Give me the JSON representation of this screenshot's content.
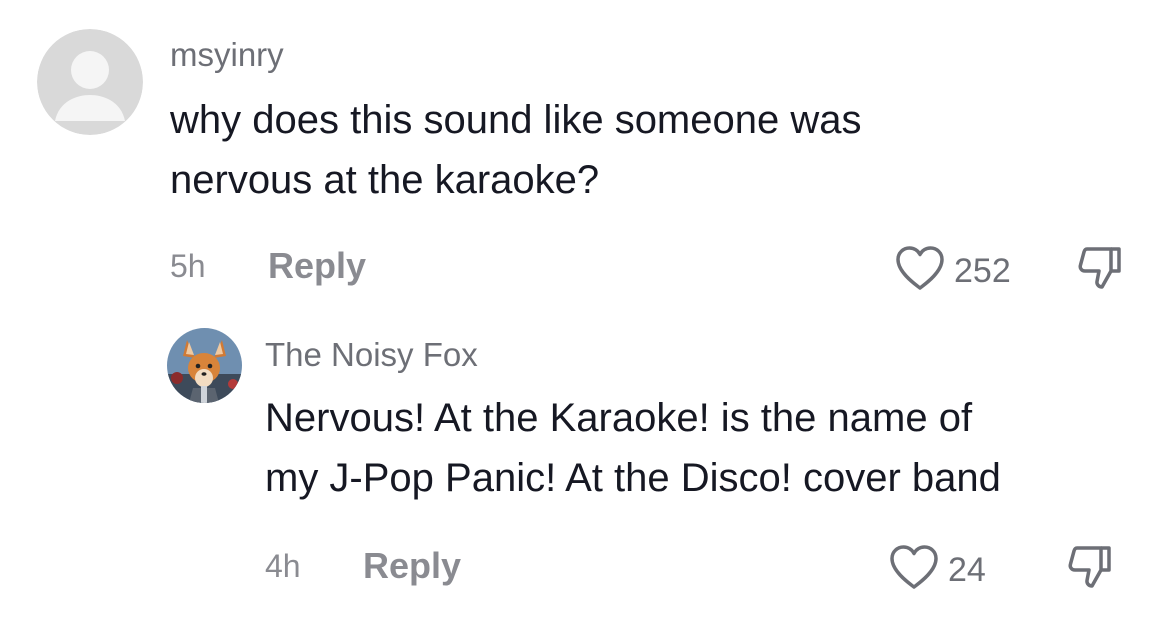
{
  "comments": [
    {
      "username": "msyinry",
      "text_lines": [
        "why does this sound like someone was",
        "nervous at the karaoke?"
      ],
      "time": "5h",
      "reply_label": "Reply",
      "likes": "252",
      "avatar_icon": "default-user-avatar-icon"
    }
  ],
  "replies": [
    {
      "username": "The Noisy Fox",
      "text_lines": [
        "Nervous! At the Karaoke! is the name of",
        "my J-Pop Panic! At the Disco! cover band"
      ],
      "time": "4h",
      "reply_label": "Reply",
      "likes": "24",
      "avatar_icon": "fox-avatar-icon"
    }
  ],
  "icons": {
    "like": "heart-outline-icon",
    "dislike": "thumbs-down-outline-icon"
  },
  "colors": {
    "primary_text": "#161823",
    "secondary_text": "#8a8b91",
    "username_text": "#6d6f76",
    "avatar_placeholder": "#d9d9d9"
  }
}
